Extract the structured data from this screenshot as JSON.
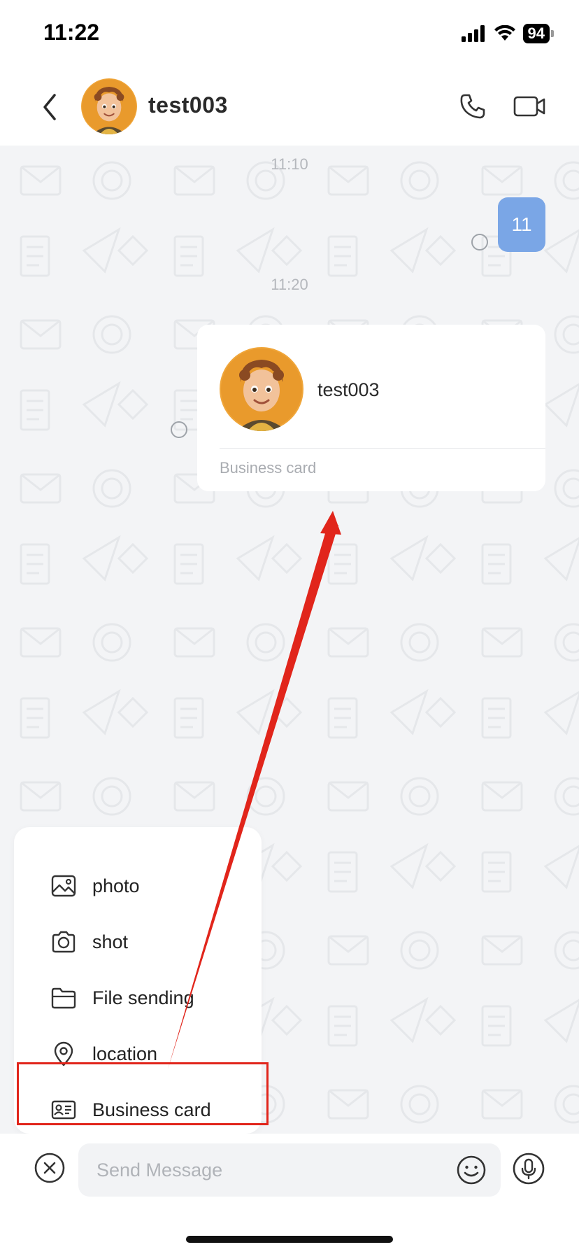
{
  "status_bar": {
    "time": "11:22",
    "battery": "94",
    "icons": [
      "signal-icon",
      "wifi-icon",
      "battery-icon"
    ]
  },
  "header": {
    "contact_name": "test003",
    "icons": [
      "back-arrow-icon",
      "phone-icon",
      "video-camera-icon"
    ]
  },
  "chat": {
    "messages": [
      {
        "timestamp": "11:10",
        "type": "text",
        "sender": "me",
        "text": "11"
      },
      {
        "timestamp": "11:20",
        "type": "business_card",
        "sender": "me",
        "card_name": "test003",
        "card_label": "Business card"
      }
    ]
  },
  "attachment_menu": {
    "items": [
      {
        "label": "photo",
        "icon": "image-icon"
      },
      {
        "label": "shot",
        "icon": "camera-icon"
      },
      {
        "label": "File sending",
        "icon": "folder-icon"
      },
      {
        "label": "location",
        "icon": "location-pin-icon"
      },
      {
        "label": "Business card",
        "icon": "contact-card-icon",
        "highlighted": true
      }
    ]
  },
  "input_bar": {
    "placeholder": "Send Message",
    "icons": [
      "close-circle-icon",
      "emoji-icon",
      "microphone-icon"
    ]
  },
  "colors": {
    "my_bubble": "#7aa6e6",
    "annotation_red": "#e1251b",
    "chat_background": "#f3f4f6"
  }
}
